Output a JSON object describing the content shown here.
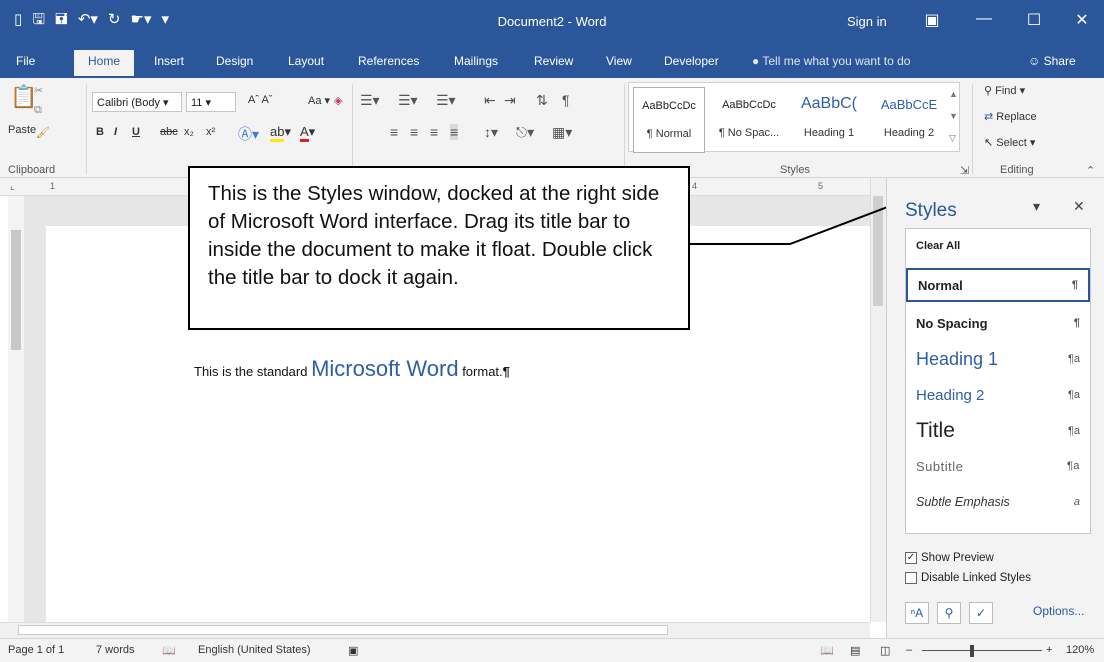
{
  "titlebar": {
    "title": "Document2 - Word",
    "signin": "Sign in",
    "qat_icons": [
      "new-doc-icon",
      "save-icon",
      "save-as-icon",
      "undo-icon",
      "redo-icon",
      "touch-mode-icon",
      "customize-icon"
    ]
  },
  "tabs": [
    "File",
    "Home",
    "Insert",
    "Design",
    "Layout",
    "References",
    "Mailings",
    "Review",
    "View",
    "Developer"
  ],
  "tell_me": "Tell me what you want to do",
  "share": "Share",
  "ribbon": {
    "paste": "Paste",
    "clipboard": "Clipboard",
    "font_name": "Calibri (Body",
    "font_size": "11",
    "change_case": "Aa",
    "bold": "B",
    "italic": "I",
    "underline": "U",
    "strikethrough": "abc",
    "subscript": "x₂",
    "superscript": "x²",
    "styles_label": "Styles",
    "editing_label": "Editing",
    "find": "Find",
    "replace": "Replace",
    "select": "Select",
    "gallery": [
      {
        "preview": "AaBbCcDc",
        "name": "¶ Normal"
      },
      {
        "preview": "AaBbCcDc",
        "name": "¶ No Spac..."
      },
      {
        "preview": "AaBbC(",
        "name": "Heading 1"
      },
      {
        "preview": "AaBbCcE",
        "name": "Heading 2"
      }
    ]
  },
  "ruler_marks": [
    "1",
    "4",
    "5"
  ],
  "document": {
    "text_before": "This is the standard ",
    "text_big": "Microsoft Word",
    "text_after": " format.",
    "pilcrow": "¶"
  },
  "callout": "This is the Styles window, docked at the right side of Microsoft Word interface. Drag its title bar to inside the document to make it float. Double click the title bar to dock it again.",
  "styles_pane": {
    "title": "Styles",
    "items": [
      {
        "label": "Clear All",
        "mark": ""
      },
      {
        "label": "Normal",
        "mark": "¶"
      },
      {
        "label": "No Spacing",
        "mark": "¶"
      },
      {
        "label": "Heading 1",
        "mark": "¶a"
      },
      {
        "label": "Heading 2",
        "mark": "¶a"
      },
      {
        "label": "Title",
        "mark": "¶a"
      },
      {
        "label": "Subtitle",
        "mark": "¶a"
      },
      {
        "label": "Subtle Emphasis",
        "mark": "a"
      }
    ],
    "show_preview": "Show Preview",
    "show_preview_checked": true,
    "disable_linked": "Disable Linked Styles",
    "disable_linked_checked": false,
    "options": "Options..."
  },
  "status": {
    "page": "Page 1 of 1",
    "words": "7 words",
    "language": "English (United States)",
    "zoom": "120%"
  },
  "colors": {
    "accent": "#2b579a",
    "heading": "#2e5fa5"
  }
}
